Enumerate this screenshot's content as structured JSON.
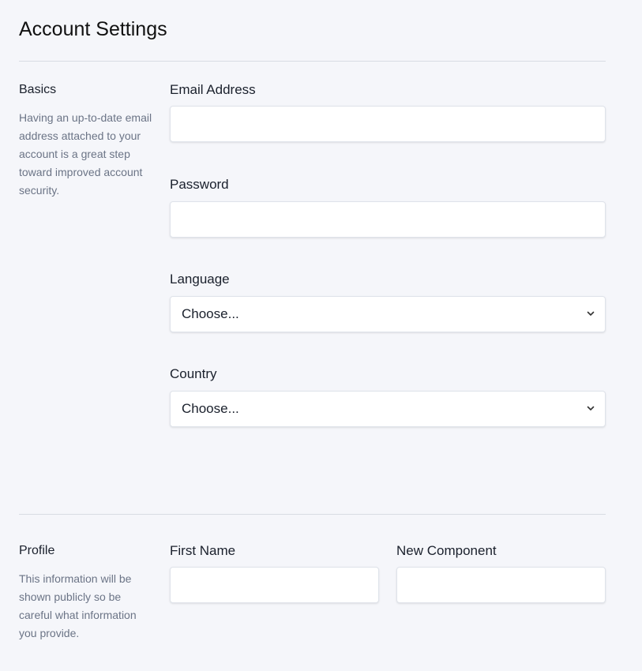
{
  "page": {
    "title": "Account Settings"
  },
  "basics": {
    "title": "Basics",
    "description": "Having an up-to-date email address attached to your account is a great step toward improved account security.",
    "email": {
      "label": "Email Address",
      "value": "",
      "placeholder": ""
    },
    "password": {
      "label": "Password",
      "value": "",
      "placeholder": ""
    },
    "language": {
      "label": "Language",
      "selected": "Choose..."
    },
    "country": {
      "label": "Country",
      "selected": "Choose..."
    }
  },
  "profile": {
    "title": "Profile",
    "description": "This information will be shown publicly so be careful what information you provide.",
    "first_name": {
      "label": "First Name",
      "value": "",
      "placeholder": ""
    },
    "new_component": {
      "label": "New Component",
      "value": "",
      "placeholder": ""
    }
  },
  "icons": {
    "select_chevron": "chevron-down-icon"
  },
  "colors": {
    "background": "#f5f6fa",
    "input_background": "#ffffff",
    "divider": "#d8dce3",
    "muted_text": "#6b7486"
  }
}
